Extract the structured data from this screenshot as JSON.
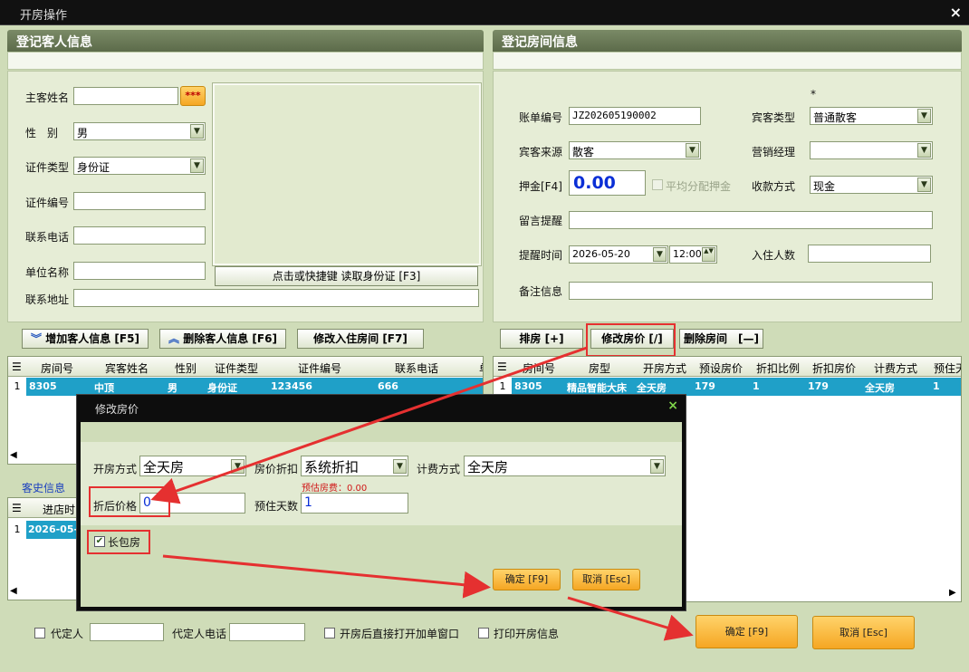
{
  "window": {
    "title": "开房操作",
    "close_glyph": "×"
  },
  "guest_panel": {
    "title": "登记客人信息",
    "fields": {
      "name_label": "主客姓名",
      "name_value": "",
      "name_btn": "***",
      "gender_label": "性　别",
      "gender_value": "男",
      "idtype_label": "证件类型",
      "idtype_value": "身份证",
      "idno_label": "证件编号",
      "idno_value": "",
      "phone_label": "联系电话",
      "phone_value": "",
      "company_label": "单位名称",
      "company_value": "",
      "address_label": "联系地址",
      "address_value": ""
    },
    "read_id_button": "点击或快捷键 读取身份证 [F3]"
  },
  "room_panel": {
    "title": "登记房间信息",
    "asterisk": "*",
    "fields": {
      "bill_label": "账单编号",
      "bill_value": "JZ202605190002",
      "guesttype_label": "宾客类型",
      "guesttype_value": "普通散客",
      "source_label": "宾客来源",
      "source_value": "散客",
      "manager_label": "营销经理",
      "manager_value": "",
      "deposit_label": "押金[F4]",
      "deposit_value": "0.00",
      "avg_deposit_label": "平均分配押金",
      "payment_label": "收款方式",
      "payment_value": "现金",
      "message_label": "留言提醒",
      "message_value": "",
      "remind_label": "提醒时间",
      "remind_date": "2026-05-20",
      "remind_time": "12:00",
      "guests_label": "入住人数",
      "guests_value": "",
      "note_label": "备注信息",
      "note_value": ""
    }
  },
  "left_toolbar": {
    "add": "增加客人信息 [F5]",
    "delete": "删除客人信息 [F6]",
    "modify": "修改入住房间 [F7]"
  },
  "right_toolbar": {
    "arrange": "排房 [+]",
    "modify_price": "修改房价 [/]",
    "delete_room": "删除房间　[—]"
  },
  "guest_grid": {
    "headers": [
      "房间号",
      "宾客姓名",
      "性别",
      "证件类型",
      "证件编号",
      "联系电话",
      "单"
    ],
    "rows": [
      {
        "idx": "1",
        "room": "8305",
        "name": "中顶",
        "gender": "男",
        "idtype": "身份证",
        "idno": "123456",
        "phone": "666"
      }
    ]
  },
  "room_grid": {
    "headers": [
      "房间号",
      "房型",
      "开房方式",
      "预设房价",
      "折扣比例",
      "折扣房价",
      "计费方式",
      "预住天"
    ],
    "rows": [
      {
        "idx": "1",
        "room": "8305",
        "type": "精品智能大床",
        "mode": "全天房",
        "price": "179",
        "ratio": "1",
        "disc_price": "179",
        "billing": "全天房",
        "days": "1"
      }
    ]
  },
  "history": {
    "label": "客史信息",
    "header": "进店时",
    "row_idx": "1",
    "row_value": "2026-05-"
  },
  "dialog": {
    "title": "修改房价",
    "close_glyph": "×",
    "mode_label": "开房方式",
    "mode_value": "全天房",
    "discount_label": "房价折扣",
    "discount_value": "系统折扣",
    "billing_label": "计费方式",
    "billing_value": "全天房",
    "est_fee": "预估房费：0.00",
    "after_price_label": "折后价格",
    "after_price_value": "0",
    "days_label": "预住天数",
    "days_value": "1",
    "long_stay_label": "长包房",
    "ok": "确定 [F9]",
    "cancel": "取消 [Esc]"
  },
  "footer": {
    "agent_label": "代定人",
    "agent_value": "",
    "agent_phone_label": "代定人电话",
    "agent_phone_value": "",
    "open_bill_label": "开房后直接打开加单窗口",
    "print_label": "打印开房信息",
    "ok": "确定 [F9]",
    "cancel": "取消 [Esc]"
  },
  "colors": {
    "accent_row": "#1fa0c8",
    "annotation": "#e53030",
    "orange_button": "#f5a623"
  }
}
